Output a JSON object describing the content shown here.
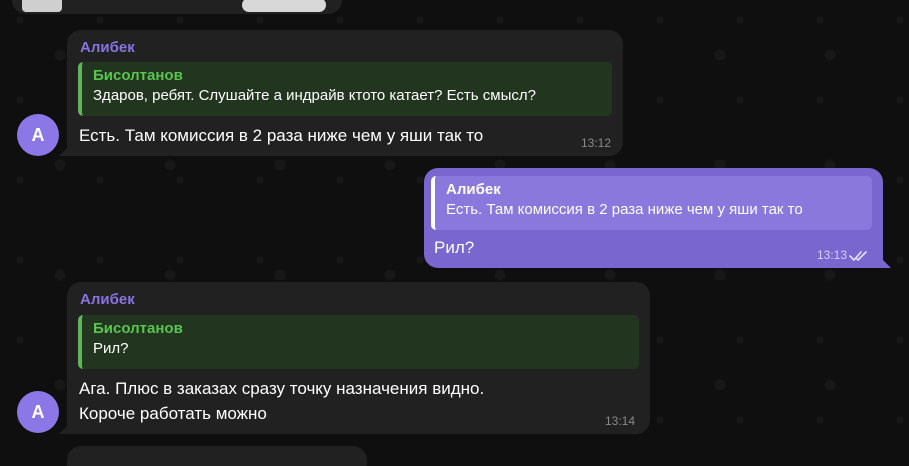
{
  "messages": [
    {
      "sender": "Алибек",
      "reply": {
        "name": "Бисолтанов",
        "text": "Здаров, ребят. Слушайте а индрайв ктото катает? Есть смысл?"
      },
      "text_lines": [
        "Есть. Там комиссия в 2 раза ниже чем у яши так то"
      ],
      "time": "13:12",
      "avatar_letter": "A"
    },
    {
      "outgoing": true,
      "reply": {
        "name": "Алибек",
        "text": "Есть. Там комиссия в 2 раза ниже чем у яши так то"
      },
      "text_lines": [
        "Рил?"
      ],
      "time": "13:13",
      "status_icon": "double-check-icon"
    },
    {
      "sender": "Алибек",
      "reply": {
        "name": "Бисолтанов",
        "text": "Рил?"
      },
      "text_lines": [
        "Ага. Плюс в заказах сразу точку назначения видно.",
        "Короче работать можно"
      ],
      "time": "13:14",
      "avatar_letter": "A"
    }
  ],
  "colors": {
    "background": "#0f0f0f",
    "incoming_bubble": "#212121",
    "outgoing_bubble": "#7a66cf",
    "sender_name": "#8774e1",
    "reply_name_green": "#59c44f",
    "avatar": "#8b78e6"
  }
}
